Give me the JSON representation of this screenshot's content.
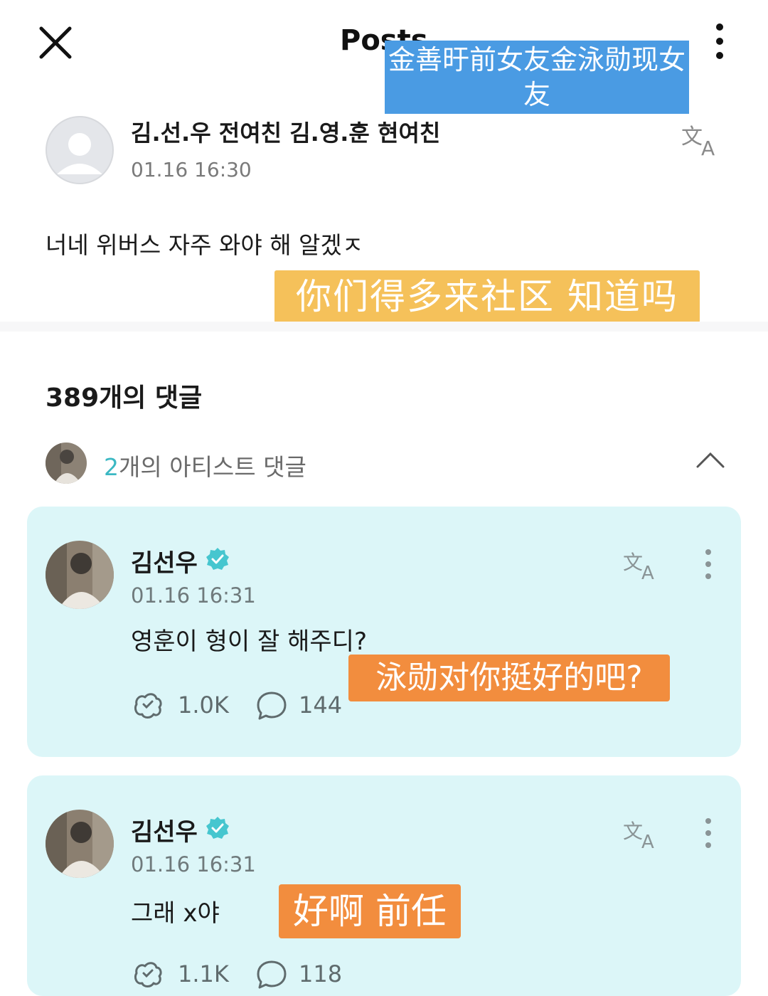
{
  "header": {
    "title": "Posts",
    "overlay_caption": "金善旴前女友金泳勋现女友"
  },
  "post": {
    "author": "김.선.우 전여친 김.영.훈 현여친",
    "time": "01.16 16:30",
    "body": "너네 위버스 자주 와야 해  알겠ㅈ",
    "overlay_caption": "你们得多来社区 知道吗"
  },
  "comments_header": "389개의 댓글",
  "artist_row": {
    "count": "2",
    "label": "개의 아티스트 댓글"
  },
  "comments": [
    {
      "author": "김선우",
      "time": "01.16 16:31",
      "text": "영훈이 형이 잘 해주디?",
      "likes": "1.0K",
      "replies": "144",
      "overlay_caption": "泳勋对你挺好的吧?"
    },
    {
      "author": "김선우",
      "time": "01.16 16:31",
      "text": "그래 x야",
      "likes": "1.1K",
      "replies": "118",
      "overlay_caption": "好啊 前任"
    }
  ],
  "colors": {
    "card_bg": "#dcf6f8",
    "verified": "#46c6cf",
    "accent": "#3bb8c3",
    "caption_blue": "#4a9be3",
    "caption_yellow": "#f5c15a",
    "caption_orange": "#f28d3e"
  },
  "icons": [
    "close-icon",
    "more-vertical-icon",
    "translate-icon",
    "verified-badge-icon",
    "chevron-up-icon",
    "like-icon",
    "comment-bubble-icon",
    "avatar-placeholder-icon"
  ]
}
